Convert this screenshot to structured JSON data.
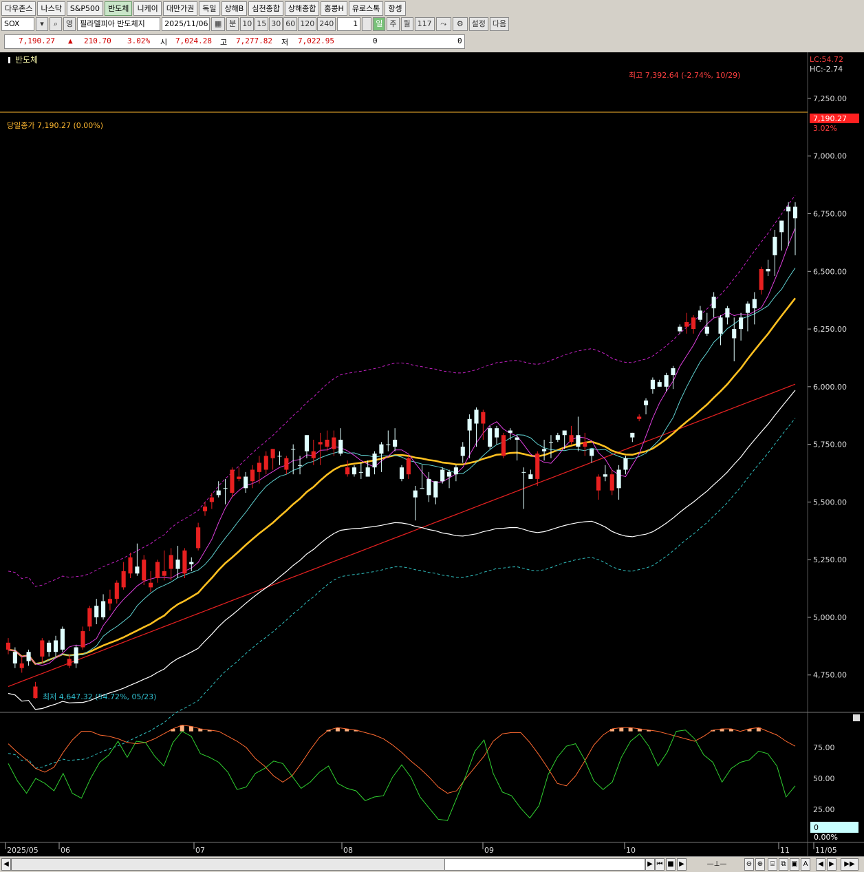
{
  "tabs": [
    "다우존스",
    "나스닥",
    "S&P500",
    "반도체",
    "니케이",
    "대만가권",
    "독일",
    "상해B",
    "심천종합",
    "상해종합",
    "홍콩H",
    "유로스톡",
    "항셍"
  ],
  "active_tab": "반도체",
  "toolbar": {
    "symbol": "SOX",
    "market_btn": "영",
    "name": "필라델피아 반도체지",
    "date": "2025/11/06",
    "minute_label": "분",
    "periods": [
      "10",
      "15",
      "30",
      "60",
      "120",
      "240"
    ],
    "period_value": "1",
    "day_label": "일",
    "week_label": "주",
    "month_label": "월",
    "count": "117",
    "settings_label": "설정",
    "next_label": "다음"
  },
  "price": {
    "close": "7,190.27",
    "change_arrow": "▲",
    "change": "210.70",
    "change_pct": "3.02%",
    "open_label": "시",
    "open": "7,024.28",
    "high_label": "고",
    "high": "7,277.82",
    "low_label": "저",
    "low": "7,022.95",
    "vol1": "0",
    "vol2": "0"
  },
  "chart": {
    "title": "반도체",
    "lc": "LC:54.72",
    "hc": "HC:-2.74",
    "close_line_label": "당일종가 7,190.27 (0.00%)",
    "high_annotation": "최고 7,392.64 (-2.74%, 10/29)",
    "low_annotation": "최저 4,647.32 (54.72%, 05/23)",
    "current_price_tag": "7,190.27",
    "current_change_tag": "3.02%",
    "y_ticks": [
      "7,250.00",
      "7,000.00",
      "6,750.00",
      "6,500.00",
      "6,250.00",
      "6,000.00",
      "5,750.00",
      "5,500.00",
      "5,250.00",
      "5,000.00",
      "4,750.00"
    ],
    "osc_ticks": [
      "75.00",
      "50.00",
      "25.00"
    ],
    "osc_tag_value": "0",
    "osc_tag_pct": "0.00%",
    "x_labels": [
      "2025/05",
      "06",
      "07",
      "08",
      "09",
      "10",
      "11",
      "11/05"
    ]
  },
  "chart_data": {
    "type": "candlestick",
    "symbol": "SOX",
    "ylim": [
      4600,
      7420
    ],
    "candles": [
      [
        4890,
        4860,
        4910,
        4840
      ],
      [
        4800,
        4850,
        4870,
        4780
      ],
      [
        4800,
        4780,
        4830,
        4760
      ],
      [
        4810,
        4850,
        4860,
        4790
      ],
      [
        4700,
        4650,
        4720,
        4647.32
      ],
      [
        4900,
        4830,
        4910,
        4800
      ],
      [
        4850,
        4890,
        4900,
        4830
      ],
      [
        4850,
        4900,
        4920,
        4830
      ],
      [
        4860,
        4950,
        4960,
        4850
      ],
      [
        4820,
        4790,
        4840,
        4780
      ],
      [
        4800,
        4870,
        4880,
        4780
      ],
      [
        4940,
        4870,
        4960,
        4860
      ],
      [
        5040,
        4960,
        5050,
        4940
      ],
      [
        5000,
        5050,
        5080,
        4970
      ],
      [
        5000,
        5070,
        5100,
        4990
      ],
      [
        5080,
        5060,
        5120,
        5030
      ],
      [
        5150,
        5080,
        5160,
        5060
      ],
      [
        5200,
        5130,
        5240,
        5120
      ],
      [
        5260,
        5190,
        5280,
        5170
      ],
      [
        5190,
        5220,
        5320,
        5180
      ],
      [
        5250,
        5160,
        5270,
        5140
      ],
      [
        5150,
        5130,
        5200,
        5110
      ],
      [
        5240,
        5170,
        5250,
        5150
      ],
      [
        5200,
        5180,
        5290,
        5160
      ],
      [
        5270,
        5210,
        5300,
        5160
      ],
      [
        5210,
        5250,
        5310,
        5170
      ],
      [
        5290,
        5190,
        5300,
        5170
      ],
      [
        5230,
        5240,
        5260,
        5200
      ],
      [
        5390,
        5300,
        5410,
        5290
      ],
      [
        5480,
        5460,
        5500,
        5440
      ],
      [
        5520,
        5500,
        5540,
        5470
      ],
      [
        5530,
        5550,
        5590,
        5520
      ],
      [
        5560,
        5560,
        5600,
        5490
      ],
      [
        5640,
        5540,
        5650,
        5520
      ],
      [
        5610,
        5600,
        5650,
        5590
      ],
      [
        5560,
        5610,
        5630,
        5540
      ],
      [
        5640,
        5590,
        5660,
        5560
      ],
      [
        5670,
        5630,
        5700,
        5580
      ],
      [
        5700,
        5640,
        5720,
        5620
      ],
      [
        5730,
        5690,
        5730,
        5640
      ],
      [
        5700,
        5700,
        5720,
        5660
      ],
      [
        5690,
        5640,
        5700,
        5620
      ],
      [
        5730,
        5730,
        5750,
        5620
      ],
      [
        5660,
        5660,
        5700,
        5620
      ],
      [
        5720,
        5790,
        5790,
        5690
      ],
      [
        5720,
        5690,
        5770,
        5660
      ],
      [
        5760,
        5750,
        5800,
        5660
      ],
      [
        5770,
        5740,
        5810,
        5720
      ],
      [
        5780,
        5730,
        5810,
        5700
      ],
      [
        5710,
        5770,
        5820,
        5700
      ],
      [
        5650,
        5620,
        5680,
        5610
      ],
      [
        5620,
        5650,
        5660,
        5610
      ],
      [
        5630,
        5630,
        5670,
        5600
      ],
      [
        5610,
        5650,
        5680,
        5610
      ],
      [
        5650,
        5710,
        5720,
        5620
      ],
      [
        5710,
        5750,
        5760,
        5630
      ],
      [
        5750,
        5750,
        5810,
        5720
      ],
      [
        5740,
        5770,
        5820,
        5720
      ],
      [
        5600,
        5650,
        5660,
        5590
      ],
      [
        5690,
        5620,
        5700,
        5600
      ],
      [
        5520,
        5550,
        5570,
        5420
      ],
      [
        5560,
        5560,
        5660,
        5560
      ],
      [
        5530,
        5600,
        5630,
        5500
      ],
      [
        5520,
        5590,
        5590,
        5490
      ],
      [
        5590,
        5640,
        5650,
        5580
      ],
      [
        5610,
        5630,
        5640,
        5560
      ],
      [
        5620,
        5650,
        5660,
        5590
      ],
      [
        5700,
        5740,
        5760,
        5670
      ],
      [
        5810,
        5860,
        5880,
        5690
      ],
      [
        5840,
        5900,
        5910,
        5740
      ],
      [
        5890,
        5840,
        5900,
        5770
      ],
      [
        5740,
        5820,
        5830,
        5730
      ],
      [
        5780,
        5820,
        5830,
        5750
      ],
      [
        5790,
        5700,
        5800,
        5690
      ],
      [
        5800,
        5810,
        5820,
        5770
      ],
      [
        5770,
        5780,
        5790,
        5680
      ],
      [
        5630,
        5630,
        5650,
        5470
      ],
      [
        5600,
        5620,
        5640,
        5600
      ],
      [
        5710,
        5600,
        5720,
        5570
      ],
      [
        5720,
        5730,
        5770,
        5680
      ],
      [
        5760,
        5760,
        5790,
        5690
      ],
      [
        5770,
        5790,
        5800,
        5760
      ],
      [
        5790,
        5810,
        5810,
        5730
      ],
      [
        5790,
        5760,
        5830,
        5750
      ],
      [
        5740,
        5790,
        5870,
        5720
      ],
      [
        5760,
        5740,
        5800,
        5700
      ],
      [
        5700,
        5730,
        5730,
        5670
      ],
      [
        5610,
        5550,
        5620,
        5510
      ],
      [
        5610,
        5620,
        5660,
        5590
      ],
      [
        5620,
        5550,
        5640,
        5530
      ],
      [
        5560,
        5640,
        5660,
        5510
      ],
      [
        5640,
        5690,
        5700,
        5620
      ],
      [
        5780,
        5800,
        5800,
        5760
      ],
      [
        5870,
        5860,
        5880,
        5850
      ],
      [
        5920,
        5940,
        5950,
        5880
      ],
      [
        5990,
        6030,
        6040,
        5970
      ],
      [
        6000,
        6020,
        6030,
        6000
      ],
      [
        6000,
        6050,
        6060,
        5980
      ],
      [
        6050,
        6080,
        6090,
        5990
      ],
      [
        6240,
        6260,
        6270,
        6230
      ],
      [
        6280,
        6260,
        6320,
        6230
      ],
      [
        6300,
        6250,
        6310,
        6230
      ],
      [
        6290,
        6330,
        6350,
        6280
      ],
      [
        6230,
        6260,
        6320,
        6220
      ],
      [
        6340,
        6390,
        6410,
        6300
      ],
      [
        6230,
        6300,
        6310,
        6180
      ],
      [
        6300,
        6340,
        6350,
        6270
      ],
      [
        6210,
        6250,
        6300,
        6110
      ],
      [
        6250,
        6300,
        6320,
        6200
      ],
      [
        6320,
        6360,
        6370,
        6240
      ],
      [
        6340,
        6380,
        6410,
        6270
      ],
      [
        6510,
        6420,
        6520,
        6400
      ],
      [
        6500,
        6510,
        6550,
        6480
      ],
      [
        6570,
        6650,
        6680,
        6480
      ],
      [
        6670,
        6720,
        6720,
        6590
      ],
      [
        6760,
        6780,
        6800,
        6610
      ],
      [
        6730,
        6780,
        6800,
        6570
      ]
    ],
    "series": [
      {
        "name": "MA5",
        "color": "#e040e0"
      },
      {
        "name": "MA10",
        "color": "#5fd0d0"
      },
      {
        "name": "MA20",
        "color": "#ffc020"
      },
      {
        "name": "MA60",
        "color": "#ffffff"
      },
      {
        "name": "MA120",
        "color": "#e02020"
      },
      {
        "name": "Envelope",
        "color": "#c020c0"
      },
      {
        "name": "Envelope-low",
        "color": "#30c0c0"
      }
    ],
    "oscillator": {
      "ylim": [
        0,
        100
      ],
      "ticks": [
        75,
        50,
        25
      ],
      "slow": [
        78,
        71,
        65,
        58,
        55,
        59,
        71,
        81,
        88,
        88,
        85,
        84,
        82,
        79,
        78,
        79,
        82,
        86,
        90,
        93,
        92,
        90,
        89,
        88,
        84,
        80,
        75,
        66,
        60,
        52,
        47,
        52,
        62,
        73,
        83,
        89,
        91,
        90,
        89,
        87,
        85,
        82,
        77,
        71,
        64,
        58,
        51,
        43,
        38,
        40,
        50,
        59,
        68,
        80,
        86,
        87,
        87,
        79,
        69,
        58,
        46,
        44,
        52,
        64,
        77,
        85,
        90,
        91,
        91,
        90,
        89,
        88,
        86,
        84,
        82,
        80,
        84,
        89,
        90,
        90,
        88,
        90,
        91,
        88,
        85,
        80,
        76
      ],
      "fast": [
        62,
        48,
        38,
        50,
        46,
        40,
        54,
        38,
        34,
        50,
        63,
        69,
        80,
        67,
        80,
        79,
        68,
        60,
        79,
        88,
        84,
        70,
        67,
        63,
        55,
        41,
        43,
        54,
        58,
        64,
        62,
        52,
        42,
        47,
        55,
        60,
        46,
        42,
        40,
        32,
        35,
        36,
        51,
        61,
        51,
        35,
        26,
        17,
        16,
        34,
        52,
        72,
        81,
        54,
        39,
        36,
        26,
        18,
        28,
        53,
        67,
        76,
        78,
        65,
        48,
        41,
        47,
        67,
        80,
        86,
        76,
        60,
        71,
        88,
        89,
        82,
        69,
        63,
        47,
        58,
        63,
        65,
        72,
        70,
        60,
        35,
        44
      ]
    }
  }
}
